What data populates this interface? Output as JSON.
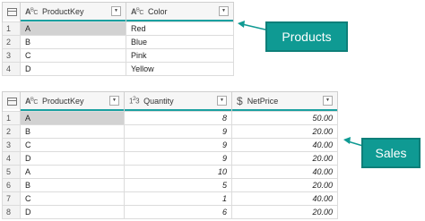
{
  "products": {
    "columns": [
      {
        "type_icon": "ABC",
        "label": "ProductKey"
      },
      {
        "type_icon": "ABC",
        "label": "Color"
      }
    ],
    "rows": [
      {
        "index": "1",
        "cells": [
          "A",
          "Red"
        ]
      },
      {
        "index": "2",
        "cells": [
          "B",
          "Blue"
        ]
      },
      {
        "index": "3",
        "cells": [
          "C",
          "Pink"
        ]
      },
      {
        "index": "4",
        "cells": [
          "D",
          "Yellow"
        ]
      }
    ],
    "callout": "Products"
  },
  "sales": {
    "columns": [
      {
        "type_icon": "ABC",
        "label": "ProductKey"
      },
      {
        "type_icon": "123",
        "label": "Quantity"
      },
      {
        "type_icon": "$",
        "label": "NetPrice"
      }
    ],
    "rows": [
      {
        "index": "1",
        "cells": [
          "A",
          "8",
          "50.00"
        ]
      },
      {
        "index": "2",
        "cells": [
          "B",
          "9",
          "20.00"
        ]
      },
      {
        "index": "3",
        "cells": [
          "C",
          "9",
          "40.00"
        ]
      },
      {
        "index": "4",
        "cells": [
          "D",
          "9",
          "20.00"
        ]
      },
      {
        "index": "5",
        "cells": [
          "A",
          "10",
          "40.00"
        ]
      },
      {
        "index": "6",
        "cells": [
          "B",
          "5",
          "20.00"
        ]
      },
      {
        "index": "7",
        "cells": [
          "C",
          "1",
          "40.00"
        ]
      },
      {
        "index": "8",
        "cells": [
          "D",
          "6",
          "20.00"
        ]
      }
    ],
    "callout": "Sales"
  },
  "colors": {
    "accent": "#1aa0a0",
    "callout_fill": "#0f9a93",
    "selected_row_fill": "#d2d2d2"
  }
}
